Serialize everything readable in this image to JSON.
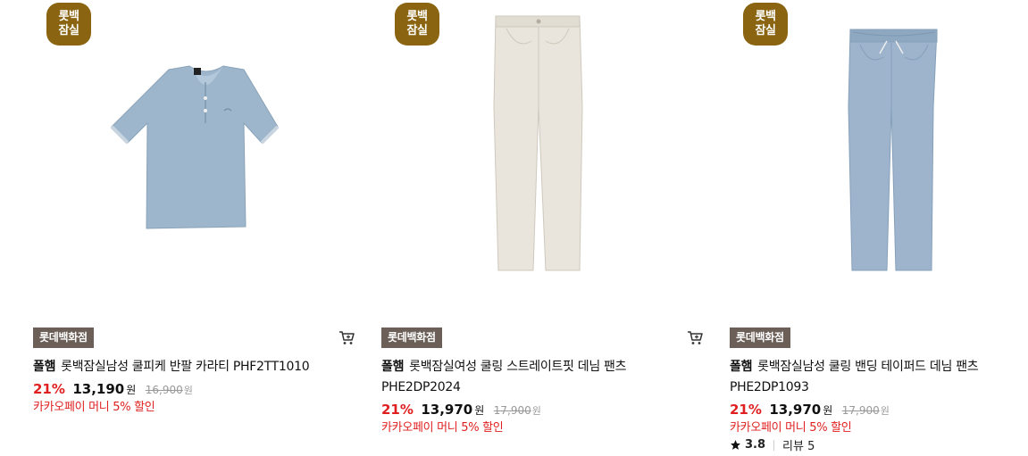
{
  "products": [
    {
      "store_badge_line1": "롯백",
      "store_badge_line2": "잠실",
      "dept_tag": "롯데백화점",
      "brand": "폴햄",
      "name": "롯백잠실남성 쿨피케 반팔 카라티 PHF2TT1010",
      "discount": "21%",
      "price": "13,190",
      "currency": "원",
      "original_price": "16,900",
      "promo": "카카오페이 머니 5% 할인",
      "image": "light-blue-polo-shirt"
    },
    {
      "store_badge_line1": "롯백",
      "store_badge_line2": "잠실",
      "dept_tag": "롯데백화점",
      "brand": "폴햄",
      "name": "롯백잠실여성 쿨링 스트레이트핏 데님 팬츠 PHE2DP2024",
      "discount": "21%",
      "price": "13,970",
      "currency": "원",
      "original_price": "17,900",
      "promo": "카카오페이 머니 5% 할인",
      "image": "ivory-straight-denim-pants"
    },
    {
      "store_badge_line1": "롯백",
      "store_badge_line2": "잠실",
      "dept_tag": "롯데백화점",
      "brand": "폴햄",
      "name": "롯백잠실남성 쿨링 밴딩 테이퍼드 데님 팬츠 PHE2DP1093",
      "discount": "21%",
      "price": "13,970",
      "currency": "원",
      "original_price": "17,900",
      "promo": "카카오페이 머니 5% 할인",
      "rating": "3.8",
      "review_label": "리뷰 5",
      "image": "light-wash-banding-denim-pants"
    }
  ],
  "icons": {
    "cart": "cart-icon",
    "star": "star-icon"
  },
  "colors": {
    "badge": "#8a6410",
    "dept_tag": "#6b5f57",
    "discount_red": "#e02020"
  }
}
